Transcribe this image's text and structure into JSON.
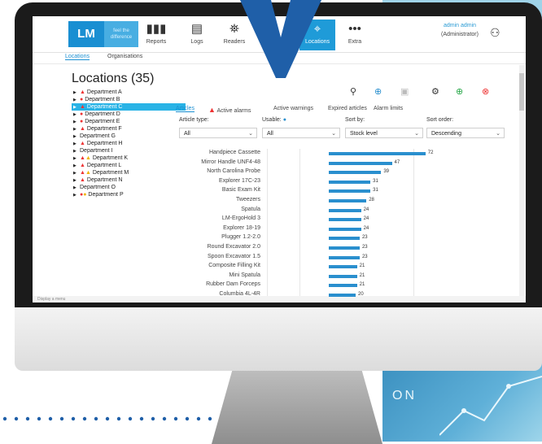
{
  "header": {
    "logo": "LM",
    "tagline": "feel the difference",
    "nav": [
      {
        "label": "Reports",
        "icon": "bar-chart-icon"
      },
      {
        "label": "Logs",
        "icon": "document-icon"
      },
      {
        "label": "Readers",
        "icon": "reader-icon"
      },
      {
        "label": "Locations",
        "icon": "location-icon",
        "active": true
      },
      {
        "label": "Extra",
        "icon": "more-icon"
      }
    ],
    "user_name": "admin admin",
    "user_role": "(Administrator)"
  },
  "subtabs": [
    "Locations",
    "Organisations"
  ],
  "sidebar": {
    "title": "Locations (35)",
    "items": [
      {
        "label": "Department A",
        "marker": "warn"
      },
      {
        "label": "Department B",
        "marker": "dot"
      },
      {
        "label": "Department C",
        "marker": "warn",
        "selected": true
      },
      {
        "label": "Department D",
        "marker": "dot"
      },
      {
        "label": "Department E",
        "marker": "dot"
      },
      {
        "label": "Department F",
        "marker": "warn"
      },
      {
        "label": "Department G",
        "marker": ""
      },
      {
        "label": "Department H",
        "marker": "warn"
      },
      {
        "label": "Department I",
        "marker": ""
      },
      {
        "label": "Department K",
        "marker": "warn2"
      },
      {
        "label": "Department L",
        "marker": "warn"
      },
      {
        "label": "Department M",
        "marker": "warn2"
      },
      {
        "label": "Department N",
        "marker": "warn"
      },
      {
        "label": "Department O",
        "marker": ""
      },
      {
        "label": "Department P",
        "marker": "dot2"
      }
    ]
  },
  "tabs": [
    "Articles",
    "Active alarms",
    "Active warnings",
    "Expired articles",
    "Alarm limits"
  ],
  "filters": {
    "article_type_label": "Article type:",
    "article_type_value": "All",
    "usable_label": "Usable:",
    "usable_value": "All",
    "sort_by_label": "Sort by:",
    "sort_by_value": "Stock level",
    "sort_order_label": "Sort order:",
    "sort_order_value": "Descending"
  },
  "status_text": "Display a menu",
  "overlay_text": "ON",
  "colors": {
    "brand": "#1a8fd2",
    "bar": "#2a8fce",
    "alert": "#e33333",
    "warning": "#f0b400"
  },
  "chart_data": {
    "type": "bar",
    "orientation": "horizontal",
    "categories": [
      "Handpiece Cassette",
      "Mirror Handle UNF4-48",
      "North Carolina Probe",
      "Explorer 17C-23",
      "Basic Exam Kit",
      "Tweezers",
      "Spatula",
      "LM-ErgoHold 3",
      "Explorer 18-19",
      "Plugger 1.2-2.0",
      "Round Excavator 2.0",
      "Spoon Excavator 1.5",
      "Composite Filling Kit",
      "Mini Spatula",
      "Rubber Dam Forceps",
      "Columbia 4L-4R"
    ],
    "values": [
      72,
      47,
      39,
      31,
      31,
      28,
      24,
      24,
      24,
      23,
      23,
      23,
      21,
      21,
      21,
      20
    ],
    "xlim": [
      0,
      80
    ]
  }
}
